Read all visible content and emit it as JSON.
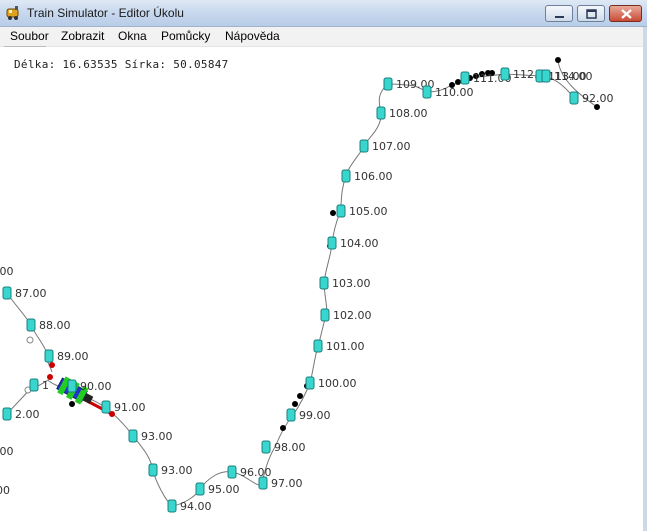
{
  "window": {
    "title": "Train Simulator - Editor Úkolu"
  },
  "menu": {
    "items": [
      "Soubor",
      "Zobrazit",
      "Okna",
      "Pomůcky",
      "Nápověda"
    ]
  },
  "status": {
    "coordinates": "Délka: 16.63535 Sírka: 50.05847"
  },
  "colors": {
    "marker_fill": "#39d6cf",
    "marker_stroke": "#1a7f7b",
    "track": "#777777",
    "point": "#000000",
    "signal_red": "#cc0000",
    "train_green": "#22cc22",
    "train_blue": "#2233cc"
  },
  "stations": [
    {
      "label": "109.00"
    },
    {
      "label": "110.00"
    },
    {
      "label": "111.00"
    },
    {
      "label": "112.00"
    },
    {
      "label": "113.00"
    },
    {
      "label": "114.00"
    },
    {
      "label": "92.00"
    },
    {
      "label": "108.00"
    },
    {
      "label": "107.00"
    },
    {
      "label": "106.00"
    },
    {
      "label": "105.00"
    },
    {
      "label": "104.00"
    },
    {
      "label": "103.00"
    },
    {
      "label": "102.00"
    },
    {
      "label": "101.00"
    },
    {
      "label": "100.00"
    },
    {
      "label": "99.00"
    },
    {
      "label": "98.00"
    },
    {
      "label": "97.00"
    },
    {
      "label": "96.00"
    },
    {
      "label": "95.00"
    },
    {
      "label": "94.00"
    },
    {
      "label": "93.00"
    },
    {
      "label": "93.00"
    },
    {
      "label": "91.00"
    },
    {
      "label": "90.00"
    },
    {
      "label": "89.00"
    },
    {
      "label": "88.00"
    },
    {
      "label": "87.00"
    },
    {
      "label": ".00"
    },
    {
      "label": "2.00"
    },
    {
      "label": ".00"
    },
    {
      "label": "00"
    },
    {
      "label": "1"
    }
  ]
}
